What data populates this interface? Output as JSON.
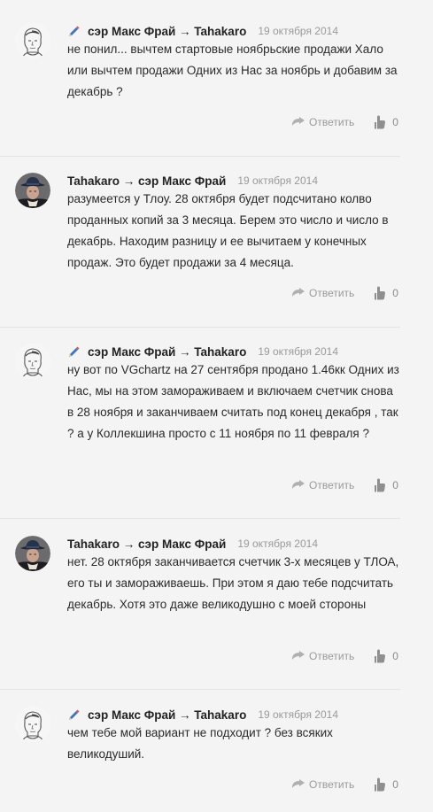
{
  "icons": {
    "pencil": "pencil-icon",
    "reply": "reply-arrow-icon",
    "like": "thumbs-up-icon",
    "avatar_sketch": "sketch-portrait-avatar",
    "avatar_photo": "hat-photo-avatar"
  },
  "colors": {
    "background": "#f4f4f4",
    "author": "#222222",
    "muted": "#9a9a9a",
    "separator": "#e4e4e4",
    "pencil_accent": "#3a73c8"
  },
  "comments": [
    {
      "author": "сэр Макс Фрай → Tahakaro",
      "date": "19 октября 2014",
      "text": "не понил... вычтем стартовые ноябрьские продажи Хало или вычтем продажи Одних из Нас за ноябрь и добавим за декабрь ?",
      "reply_label": "Ответить",
      "likes": "0"
    },
    {
      "author": "Tahakaro → сэр Макс Фрай",
      "date": "19 октября 2014",
      "text": "разумеется у Тлоу. 28 октября будет подсчитано колво проданных копий за 3 месяца. Берем это число и число в декабрь. Находим разницу и ее вычитаем у конечных продаж. Это будет продажи за 4 месяца.",
      "reply_label": "Ответить",
      "likes": "0"
    },
    {
      "author": "сэр Макс Фрай → Tahakaro",
      "date": "19 октября 2014",
      "text": "ну вот по VGchartz на 27 сентября продано 1.46кк Одних из Нас, мы на этом замораживаем и включаем счетчик снова в 28 ноября и заканчиваем считать под конец декабря , так ? а у Коллекшина просто с 11 ноября по 11 февраля ?",
      "reply_label": "Ответить",
      "likes": "0"
    },
    {
      "author": "Tahakaro → сэр Макс Фрай",
      "date": "19 октября 2014",
      "text": "нет. 28 октября заканчивается счетчик 3-х месяцев у ТЛОА, его ты и замораживаешь. При этом я даю тебе подсчитать декабрь. Хотя это даже великодушно с моей стороны",
      "reply_label": "Ответить",
      "likes": "0"
    },
    {
      "author": "сэр Макс Фрай → Tahakaro",
      "date": "19 октября 2014",
      "text": "чем тебе мой вариант не подходит ? без всяких великодуший.",
      "reply_label": "Ответить",
      "likes": "0"
    }
  ]
}
